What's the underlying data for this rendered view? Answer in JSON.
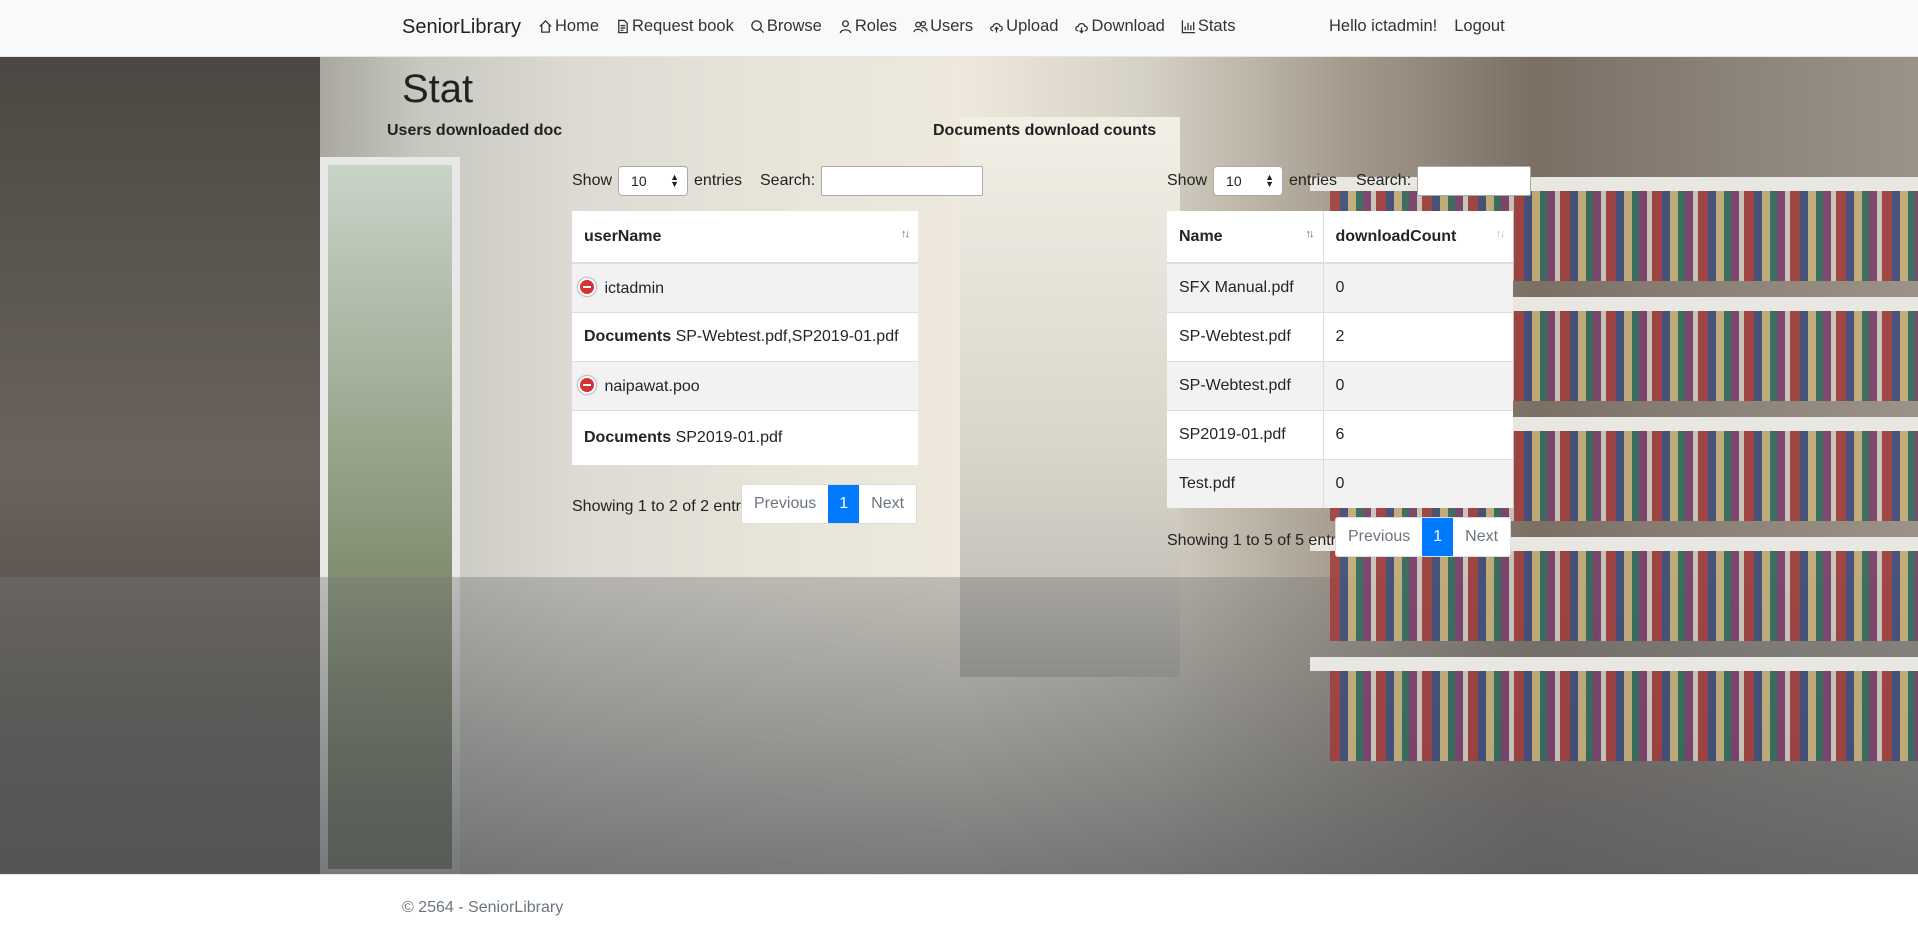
{
  "navbar": {
    "brand": "SeniorLibrary",
    "items": [
      {
        "label": "Home",
        "icon": "home-icon"
      },
      {
        "label": "Request book",
        "icon": "document-icon"
      },
      {
        "label": "Browse",
        "icon": "search-icon"
      },
      {
        "label": "Roles",
        "icon": "person-icon"
      },
      {
        "label": "Users",
        "icon": "people-icon"
      },
      {
        "label": "Upload",
        "icon": "cloud-upload-icon"
      },
      {
        "label": "Download",
        "icon": "cloud-download-icon"
      },
      {
        "label": "Stats",
        "icon": "bar-chart-icon"
      }
    ],
    "greeting": "Hello ictadmin!",
    "logout": "Logout"
  },
  "page": {
    "title": "Stat"
  },
  "users_table": {
    "section_title": "Users downloaded doc",
    "show_label": "Show",
    "entries_label": "entries",
    "page_length": "10",
    "search_label": "Search:",
    "search_value": "",
    "column_header": "userName",
    "rows": [
      {
        "user": "ictadmin",
        "documents_label": "Documents",
        "documents": "SP-Webtest.pdf,SP2019-01.pdf"
      },
      {
        "user": "naipawat.poo",
        "documents_label": "Documents",
        "documents": "SP2019-01.pdf"
      }
    ],
    "info": "Showing 1 to 2 of 2 entries",
    "previous": "Previous",
    "page": "1",
    "next": "Next"
  },
  "docs_table": {
    "section_title": "Documents download counts",
    "show_label": "Show",
    "entries_label": "entries",
    "page_length": "10",
    "search_label": "Search:",
    "search_value": "",
    "columns": [
      "Name",
      "downloadCount"
    ],
    "rows": [
      {
        "name": "SFX Manual.pdf",
        "count": "0"
      },
      {
        "name": "SP-Webtest.pdf",
        "count": "2"
      },
      {
        "name": "SP-Webtest.pdf",
        "count": "0"
      },
      {
        "name": "SP2019-01.pdf",
        "count": "6"
      },
      {
        "name": "Test.pdf",
        "count": "0"
      }
    ],
    "info": "Showing 1 to 5 of 5 entries",
    "previous": "Previous",
    "page": "1",
    "next": "Next"
  },
  "footer": {
    "text": "© 2564 - SeniorLibrary"
  },
  "colors": {
    "accent": "#007bff",
    "remove": "#d33333"
  }
}
